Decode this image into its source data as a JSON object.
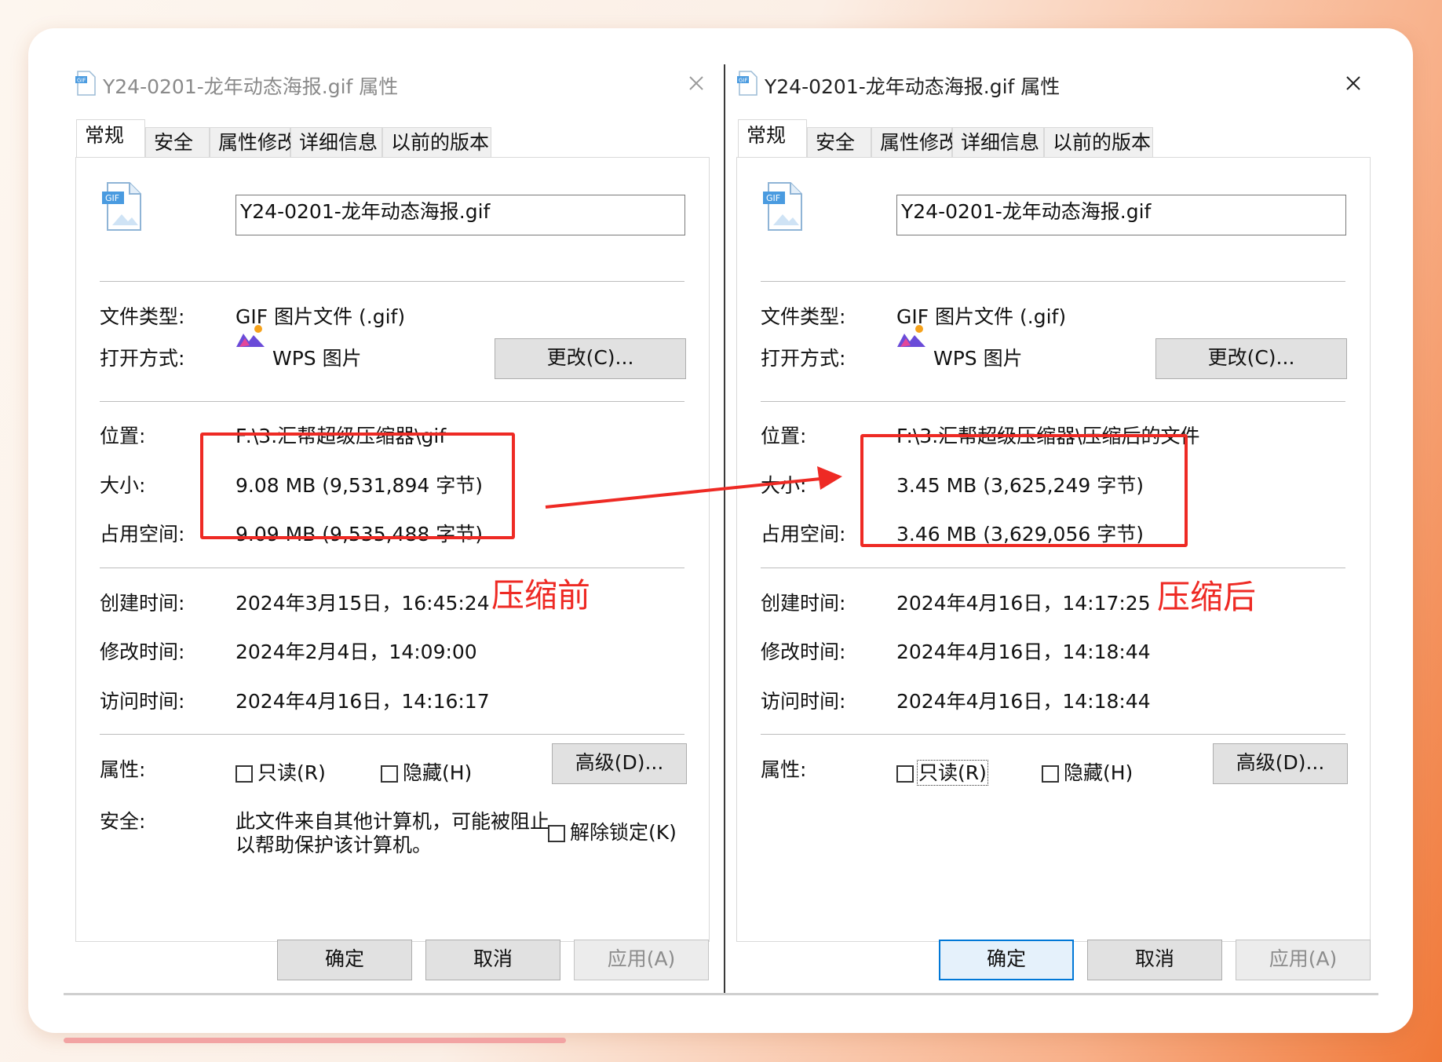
{
  "left": {
    "title": "Y24-0201-龙年动态海报.gif 属性",
    "tabs": [
      "常规",
      "安全",
      "属性修改",
      "详细信息",
      "以前的版本"
    ],
    "filename": "Y24-0201-龙年动态海报.gif",
    "file_type_label": "文件类型:",
    "file_type": "GIF 图片文件 (.gif)",
    "open_with_label": "打开方式:",
    "open_with": "WPS 图片",
    "change_button": "更改(C)...",
    "location_label": "位置:",
    "location": "F:\\3.汇帮超级压缩器\\gif",
    "size_label": "大小:",
    "size": "9.08 MB (9,531,894 字节)",
    "disk_label": "占用空间:",
    "disk": "9.09 MB (9,535,488 字节)",
    "created_label": "创建时间:",
    "created": "2024年3月15日，16:45:24",
    "modified_label": "修改时间:",
    "modified": "2024年2月4日，14:09:00",
    "accessed_label": "访问时间:",
    "accessed": "2024年4月16日，14:16:17",
    "attrs_label": "属性:",
    "readonly": "只读(R)",
    "hidden": "隐藏(H)",
    "advanced_button": "高级(D)...",
    "security_label": "安全:",
    "security_text_1": "此文件来自其他计算机，可能被阻止",
    "security_text_2": "以帮助保护该计算机。",
    "unblock": "解除锁定(K)",
    "ok": "确定",
    "cancel": "取消",
    "apply": "应用(A)"
  },
  "right": {
    "title": "Y24-0201-龙年动态海报.gif 属性",
    "tabs": [
      "常规",
      "安全",
      "属性修改",
      "详细信息",
      "以前的版本"
    ],
    "filename": "Y24-0201-龙年动态海报.gif",
    "file_type_label": "文件类型:",
    "file_type": "GIF 图片文件 (.gif)",
    "open_with_label": "打开方式:",
    "open_with": "WPS 图片",
    "change_button": "更改(C)...",
    "location_label": "位置:",
    "location": "F:\\3.汇帮超级压缩器\\压缩后的文件",
    "size_label": "大小:",
    "size": "3.45 MB (3,625,249 字节)",
    "disk_label": "占用空间:",
    "disk": "3.46 MB (3,629,056 字节)",
    "created_label": "创建时间:",
    "created": "2024年4月16日，14:17:25",
    "modified_label": "修改时间:",
    "modified": "2024年4月16日，14:18:44",
    "accessed_label": "访问时间:",
    "accessed": "2024年4月16日，14:18:44",
    "attrs_label": "属性:",
    "readonly": "只读(R)",
    "hidden": "隐藏(H)",
    "advanced_button": "高级(D)...",
    "ok": "确定",
    "cancel": "取消",
    "apply": "应用(A)"
  },
  "annotations": {
    "before": "压缩前",
    "after": "压缩后",
    "accent_color": "#ee2a24"
  },
  "icons": [
    "gif-file-icon",
    "close-icon",
    "wps-image-icon",
    "red-arrow"
  ]
}
